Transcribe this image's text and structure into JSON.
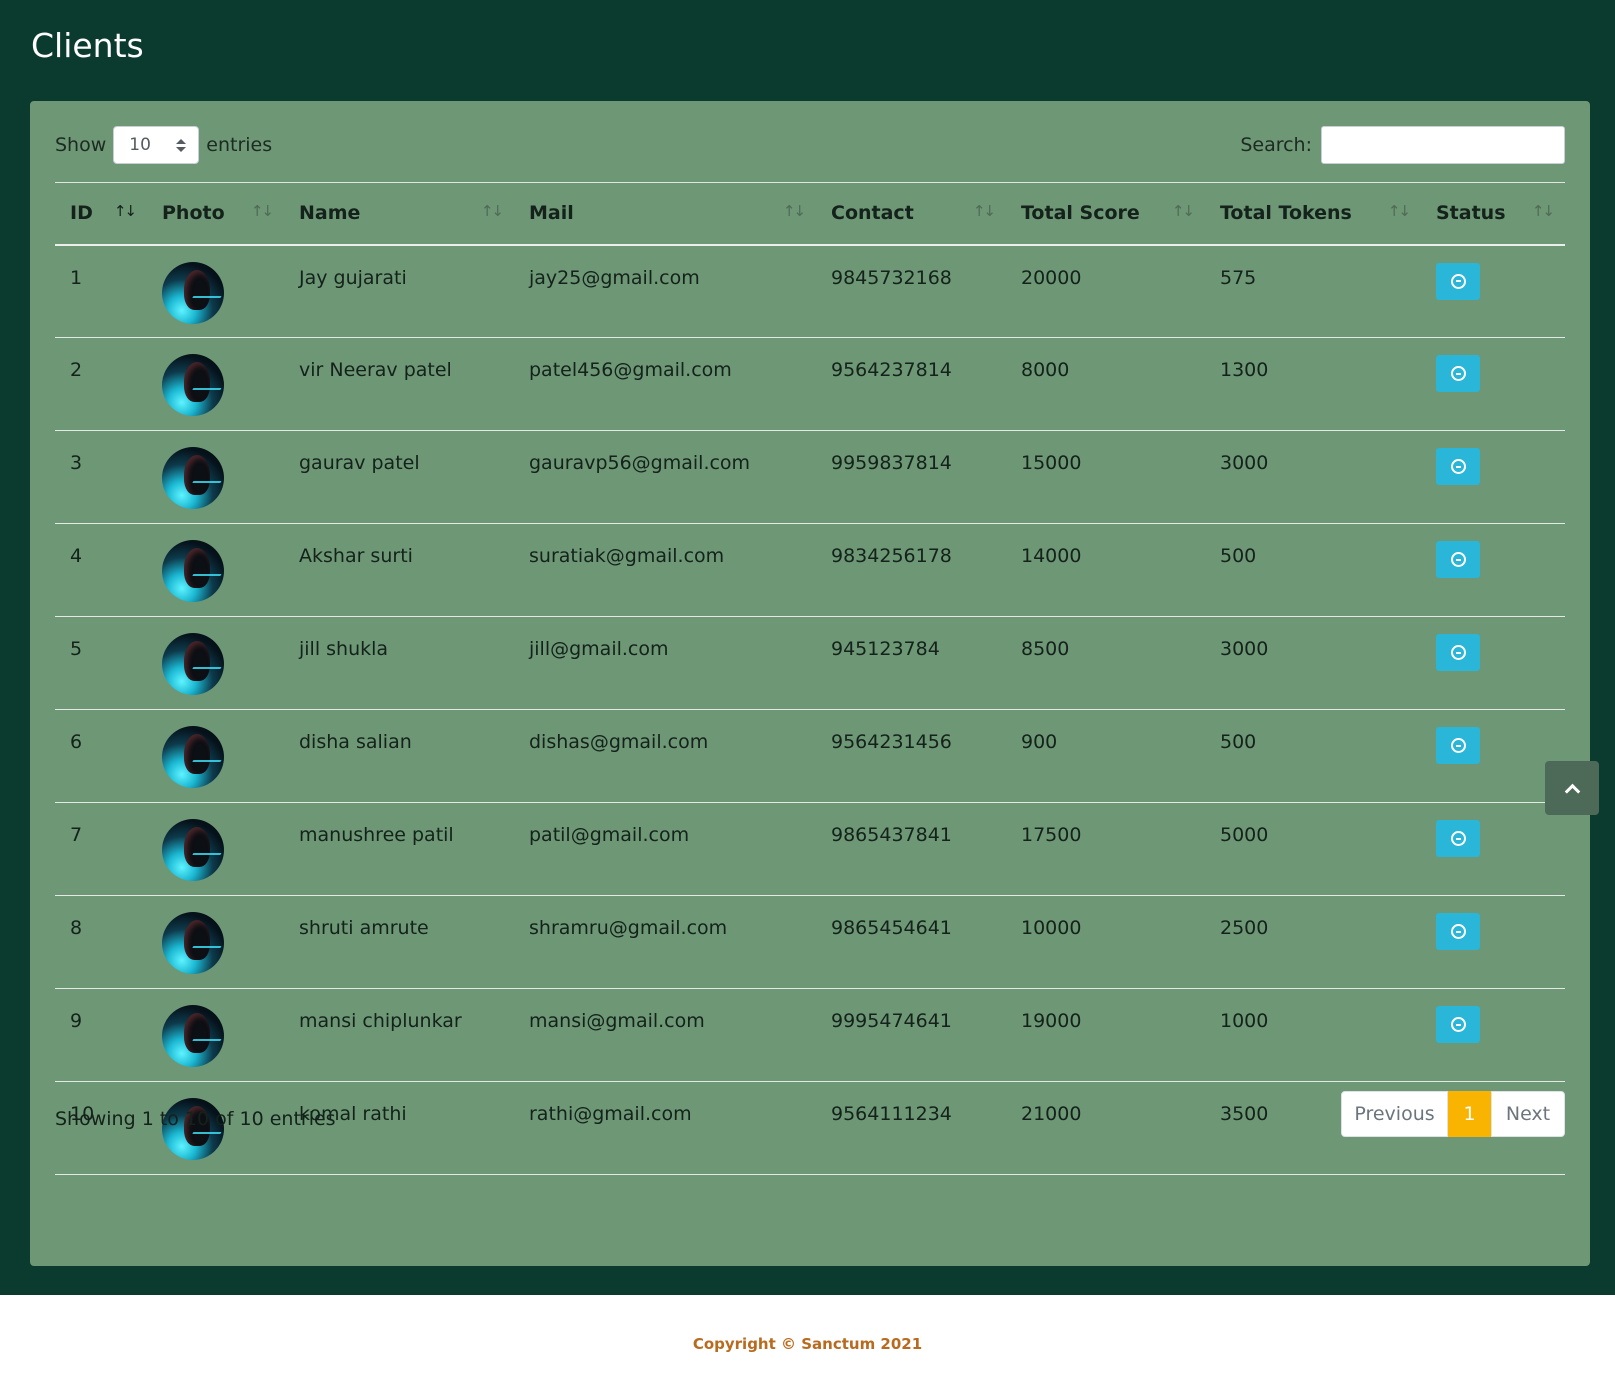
{
  "page": {
    "title": "Clients"
  },
  "controls": {
    "show_label": "Show",
    "entries_value": "10",
    "entries_label": "entries",
    "search_label": "Search:",
    "search_value": ""
  },
  "table": {
    "columns": [
      "ID",
      "Photo",
      "Name",
      "Mail",
      "Contact",
      "Total Score",
      "Total Tokens",
      "Status"
    ],
    "sort_glyph": "↑↓",
    "rows": [
      {
        "id": "1",
        "name": "Jay gujarati",
        "mail": "jay25@gmail.com",
        "contact": "9845732168",
        "score": "20000",
        "tokens": "575"
      },
      {
        "id": "2",
        "name": "vir Neerav patel",
        "mail": "patel456@gmail.com",
        "contact": "9564237814",
        "score": "8000",
        "tokens": "1300"
      },
      {
        "id": "3",
        "name": "gaurav patel",
        "mail": "gauravp56@gmail.com",
        "contact": "9959837814",
        "score": "15000",
        "tokens": "3000"
      },
      {
        "id": "4",
        "name": "Akshar surti",
        "mail": "suratiak@gmail.com",
        "contact": "9834256178",
        "score": "14000",
        "tokens": "500"
      },
      {
        "id": "5",
        "name": "jill shukla",
        "mail": "jill@gmail.com",
        "contact": "945123784",
        "score": "8500",
        "tokens": "3000"
      },
      {
        "id": "6",
        "name": "disha salian",
        "mail": "dishas@gmail.com",
        "contact": "9564231456",
        "score": "900",
        "tokens": "500"
      },
      {
        "id": "7",
        "name": "manushree patil",
        "mail": "patil@gmail.com",
        "contact": "9865437841",
        "score": "17500",
        "tokens": "5000"
      },
      {
        "id": "8",
        "name": "shruti amrute",
        "mail": "shramru@gmail.com",
        "contact": "9865454641",
        "score": "10000",
        "tokens": "2500"
      },
      {
        "id": "9",
        "name": "mansi chiplunkar",
        "mail": "mansi@gmail.com",
        "contact": "9995474641",
        "score": "19000",
        "tokens": "1000"
      },
      {
        "id": "10",
        "name": "komal rathi",
        "mail": "rathi@gmail.com",
        "contact": "9564111234",
        "score": "21000",
        "tokens": "3500"
      }
    ]
  },
  "info_text": "Showing 1 to 10 of 10 entries",
  "pagination": {
    "previous": "Previous",
    "current": "1",
    "next": "Next"
  },
  "footer": {
    "copyright": "Copyright © Sanctum 2021"
  },
  "colors": {
    "page_bg": "#0b3b2e",
    "card_bg": "#6d9775",
    "status_button": "#29b6d8",
    "active_page": "#f8b400",
    "footer_text": "#b86a1e"
  },
  "icons": {
    "status": "minus-circle-icon",
    "back_to_top": "chevron-up-icon",
    "sort": "sort-arrows-icon",
    "select": "select-arrows-icon"
  }
}
